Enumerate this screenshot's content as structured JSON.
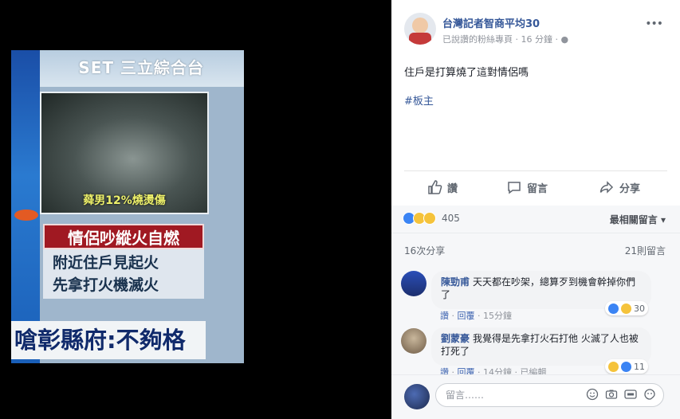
{
  "photo": {
    "channel_logo": "SET 三立綜合台",
    "video_caption": "蕣男12%燒燙傷",
    "headline": "情侶吵縱火自燃",
    "subline1": "附近住戶見起火",
    "subline2": "先拿打火機滅火",
    "ticker": "嗆彰縣府:不夠格"
  },
  "post": {
    "page_name": "台灣記者智商平均30",
    "meta": "已說讚的粉絲專頁 · 16 分鐘 · ",
    "text": "住戶是打算燒了這對情侶嗎",
    "tag": "#板主",
    "actions": {
      "like": "讚",
      "comment": "留言",
      "share": "分享"
    },
    "reaction_count": "405",
    "sort_label": "最相關留言 ▾",
    "shares": "16次分享",
    "comments_count": "21則留言"
  },
  "comments": [
    {
      "author": "陳勁甫",
      "text": "天天都在吵架，總算歹到機會幹掉你們了",
      "like": "讚",
      "reply": "回覆",
      "time": "15分鐘",
      "reaction_count": "30"
    },
    {
      "author": "劉蒙豪",
      "text": "我覺得是先拿打火石打他 火滅了人也被打死了",
      "like": "讚",
      "reply": "回覆",
      "time": "14分鐘",
      "edited": "已編輯",
      "reaction_count": "11"
    }
  ],
  "compose": {
    "placeholder": "留言……"
  },
  "colors": {
    "link": "#365899",
    "accent": "#4267b2",
    "headline_red": "#a01922"
  }
}
